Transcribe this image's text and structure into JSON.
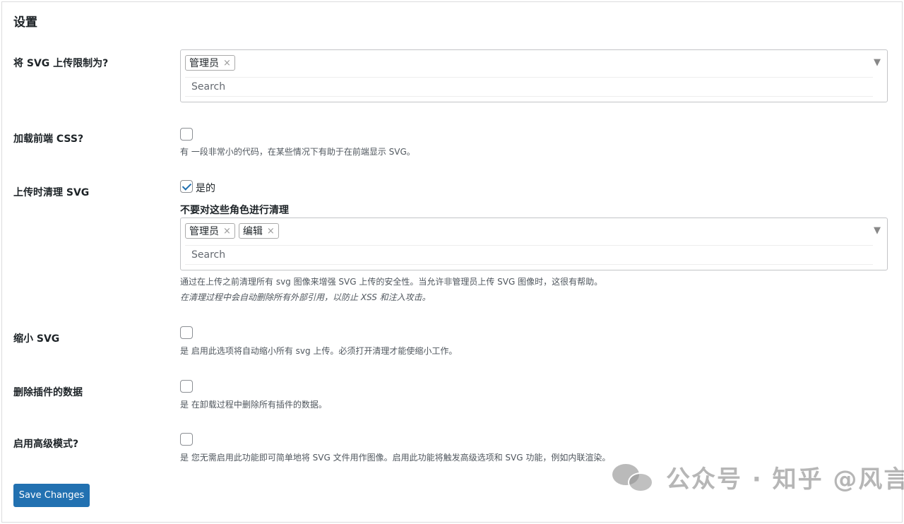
{
  "page": {
    "title": "设置"
  },
  "restrict": {
    "label": "将 SVG 上传限制为?",
    "tags": [
      {
        "label": "管理员",
        "remove": "×"
      }
    ],
    "search_placeholder": "Search",
    "arrow": "▼"
  },
  "frontend_css": {
    "label": "加载前端 CSS?",
    "checked": false,
    "description": "有 一段非常小的代码，在某些情况下有助于在前端显示 SVG。"
  },
  "sanitize": {
    "label": "上传时清理 SVG",
    "checked": true,
    "checkbox_label": "是的",
    "exclude_heading": "不要对这些角色进行清理",
    "tags": [
      {
        "label": "管理员",
        "remove": "×"
      },
      {
        "label": "编辑",
        "remove": "×"
      }
    ],
    "search_placeholder": "Search",
    "arrow": "▼",
    "description": "通过在上传之前清理所有 svg 图像来增强 SVG 上传的安全性。当允许非管理员上传 SVG 图像时，这很有帮助。",
    "note": "在清理过程中会自动删除所有外部引用，以防止 XSS 和注入攻击。"
  },
  "minify": {
    "label": "缩小 SVG",
    "checked": false,
    "description": "是 启用此选项将自动缩小所有 svg 上传。必须打开清理才能使缩小工作。"
  },
  "delete_data": {
    "label": "删除插件的数据",
    "checked": false,
    "description": "是 在卸载过程中删除所有插件的数据。"
  },
  "advanced": {
    "label": "启用高级模式?",
    "checked": false,
    "description": "是 您无需启用此功能即可简单地将 SVG 文件用作图像。启用此功能将触发高级选项和 SVG 功能，例如内联渲染。"
  },
  "actions": {
    "save_label": "Save Changes"
  },
  "watermark": {
    "text": "公众号 · 知乎 @风言"
  },
  "colors": {
    "accent": "#2271b1",
    "text": "#1d2327",
    "muted": "#50575e"
  }
}
